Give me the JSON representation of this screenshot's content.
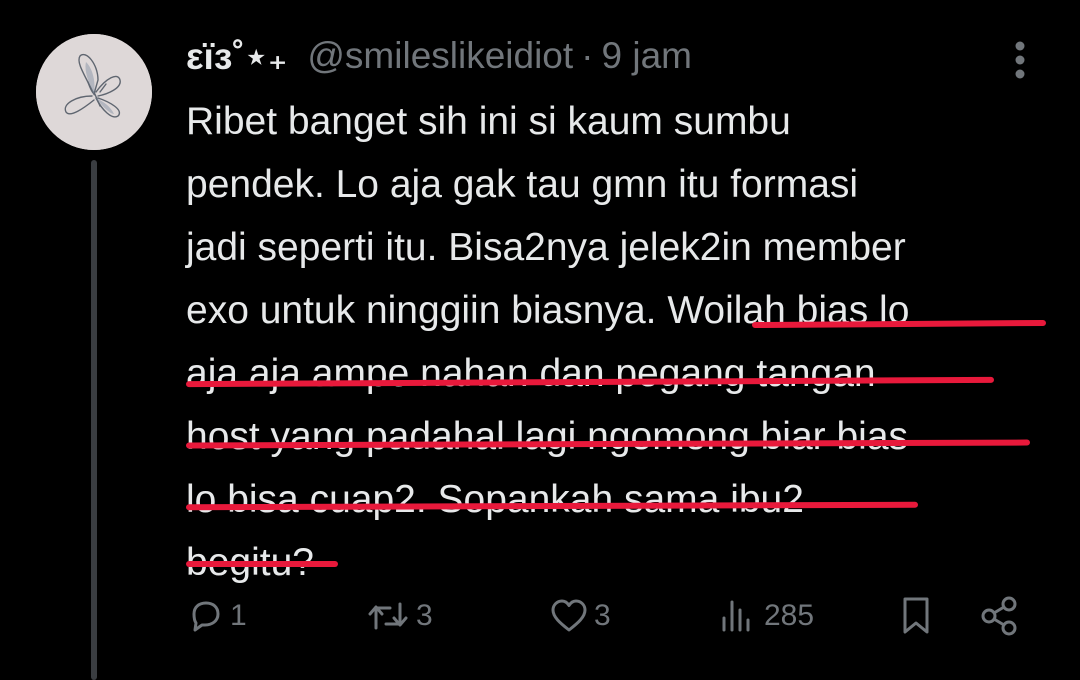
{
  "tweet": {
    "author": {
      "display_name": "εїз˚⋆₊",
      "handle": "@smileslikeidiot"
    },
    "separator": "·",
    "timestamp": "9 jam",
    "text_lines": [
      "Ribet banget sih ini si kaum sumbu",
      "pendek. Lo aja gak tau gmn itu formasi",
      "jadi seperti itu. Bisa2nya jelek2in member",
      "exo untuk ninggiin biasnya. Woilah bias lo",
      "aja aja ampe nahan dan pegang tangan",
      "host yang padahal lagi ngomong biar bias",
      "lo bisa cuap2. Sopankah sama ibu2",
      "begitu?"
    ],
    "stats": {
      "replies": "1",
      "reposts": "3",
      "likes": "3",
      "views": "285"
    }
  },
  "icons": {
    "avatar": "butterfly-sketch-icon",
    "more": "more-vertical-icon",
    "reply": "reply-icon",
    "repost": "repost-icon",
    "like": "heart-icon",
    "views": "views-chart-icon",
    "bookmark": "bookmark-icon",
    "share": "share-icon"
  },
  "colors": {
    "background": "#000000",
    "text_primary": "#e7e9ea",
    "text_secondary": "#71767b",
    "thread_line": "#3a3d41",
    "avatar_bg": "#ded8d8",
    "annotation_underline": "#e8193b"
  }
}
